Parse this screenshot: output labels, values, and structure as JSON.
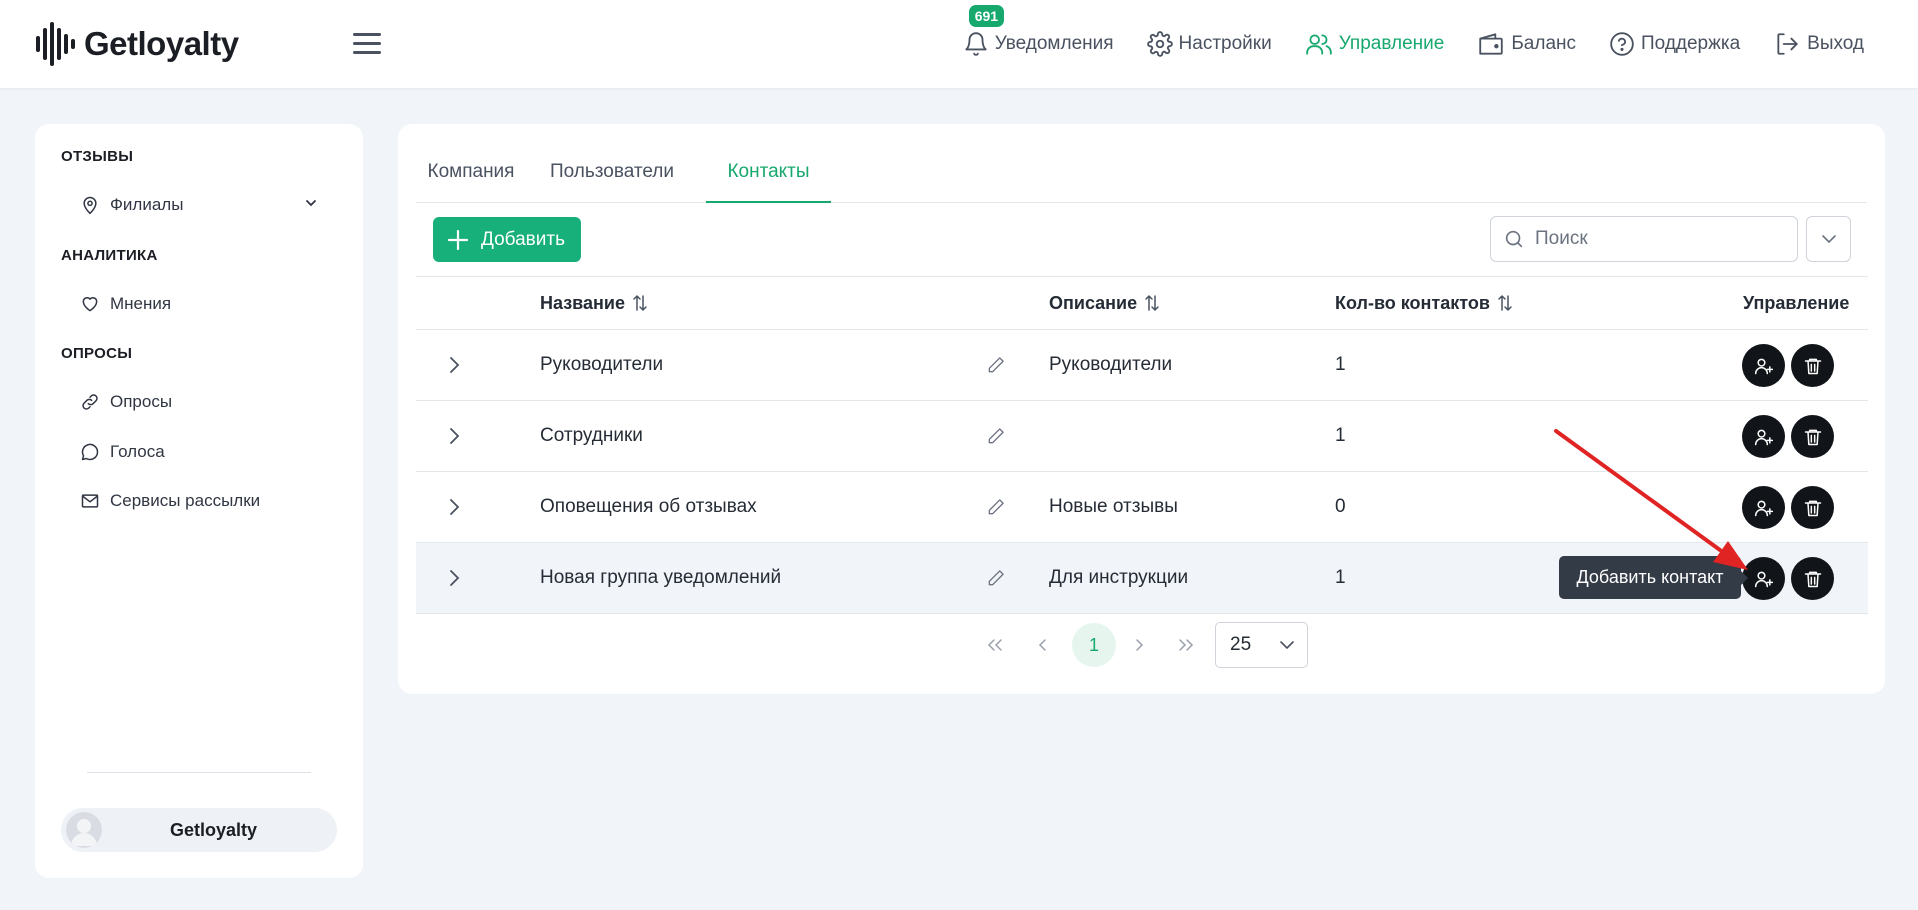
{
  "header": {
    "logo_text": "Getloyalty",
    "nav": [
      {
        "label": "Уведомления",
        "icon": "bell-icon"
      },
      {
        "label": "Настройки",
        "icon": "gear-icon"
      },
      {
        "label": "Управление",
        "icon": "users-icon",
        "active": true
      },
      {
        "label": "Баланс",
        "icon": "wallet-icon"
      },
      {
        "label": "Поддержка",
        "icon": "help-icon"
      },
      {
        "label": "Выход",
        "icon": "logout-icon"
      }
    ],
    "notifications_count": "691"
  },
  "sidebar": {
    "sections": [
      {
        "title": "ОТЗЫВЫ",
        "items": [
          {
            "label": "Филиалы",
            "icon": "pin-icon"
          }
        ]
      },
      {
        "title": "АНАЛИТИКА",
        "items": [
          {
            "label": "Мнения",
            "icon": "heart-icon"
          }
        ]
      },
      {
        "title": "ОПРОСЫ",
        "items": [
          {
            "label": "Опросы",
            "icon": "link-icon"
          },
          {
            "label": "Голоса",
            "icon": "chat-icon"
          },
          {
            "label": "Сервисы рассылки",
            "icon": "mail-icon"
          }
        ]
      }
    ],
    "user_name": "Getloyalty"
  },
  "main": {
    "tabs": [
      {
        "label": "Компания"
      },
      {
        "label": "Пользователи"
      },
      {
        "label": "Контакты",
        "active": true
      }
    ],
    "add_label": "Добавить",
    "search_placeholder": "Поиск",
    "columns": {
      "name": "Название",
      "description": "Описание",
      "count": "Кол-во контактов",
      "actions": "Управление"
    },
    "rows": [
      {
        "name": "Руководители",
        "description": "Руководители",
        "count": "1"
      },
      {
        "name": "Сотрудники",
        "description": "",
        "count": "1"
      },
      {
        "name": "Оповещения об отзывах",
        "description": "Новые отзывы",
        "count": "0"
      },
      {
        "name": "Новая группа уведомлений",
        "description": "Для инструкции",
        "count": "1"
      }
    ],
    "tooltip": "Добавить контакт",
    "pagination": {
      "current_page": "1",
      "page_size": "25"
    }
  },
  "colors": {
    "accent": "#17a86e",
    "button": "#17b07a",
    "dark_action": "#111418",
    "annotation_arrow": "#e02424"
  }
}
